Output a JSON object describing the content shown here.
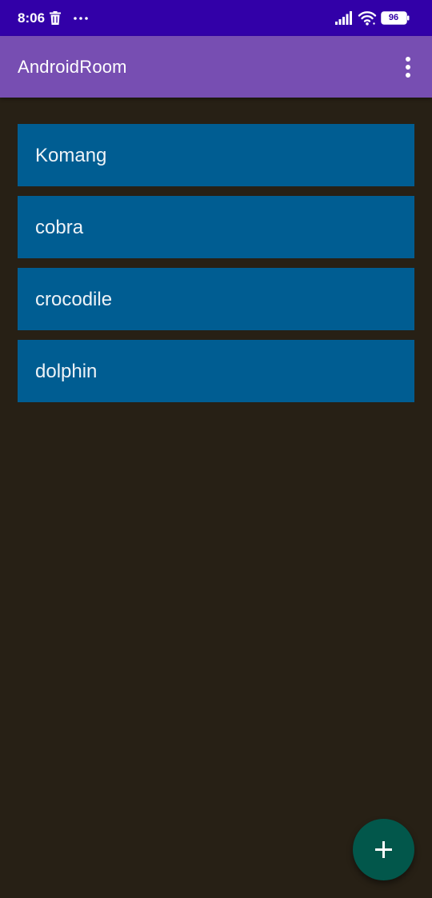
{
  "status_bar": {
    "time": "8:06",
    "battery": "96",
    "icons": [
      "trash-icon",
      "more-dots-icon",
      "signal-icon",
      "wifi-icon",
      "battery-icon"
    ]
  },
  "app_bar": {
    "title": "AndroidRoom",
    "menu_icon": "overflow-menu-icon"
  },
  "list": {
    "items": [
      {
        "label": "Komang"
      },
      {
        "label": "cobra"
      },
      {
        "label": "crocodile"
      },
      {
        "label": "dolphin"
      }
    ]
  },
  "fab": {
    "icon": "plus-icon"
  },
  "colors": {
    "status_bar": "#3200a8",
    "app_bar": "#774eb2",
    "background": "#272015",
    "list_item": "#005d92",
    "fab": "#02574b"
  }
}
